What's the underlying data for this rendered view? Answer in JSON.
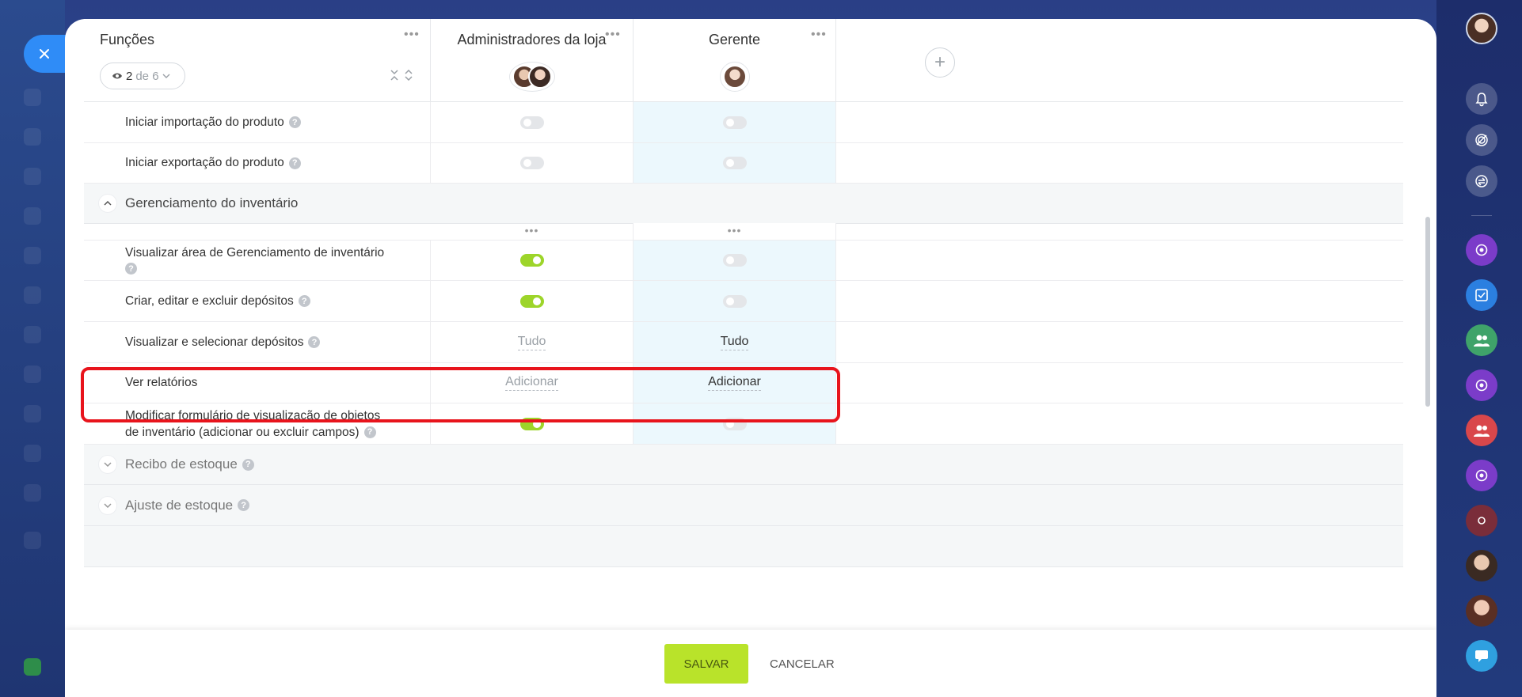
{
  "header": {
    "functions_label": "Funções",
    "filter": {
      "count": "2",
      "of_label": "de 6"
    },
    "columns": [
      {
        "title": "Administradores da loja"
      },
      {
        "title": "Gerente"
      }
    ]
  },
  "rows_top": [
    {
      "label": "Iniciar importação do produto"
    },
    {
      "label": "Iniciar exportação do produto"
    }
  ],
  "section_inventory": {
    "title": "Gerenciamento do inventário"
  },
  "rows_inventory": [
    {
      "label_line1": "Visualizar área de Gerenciamento de inventário",
      "admin": "on",
      "manager": "off"
    },
    {
      "label": "Criar, editar e excluir depósitos",
      "admin": "on",
      "manager": "off"
    },
    {
      "label": "Visualizar e selecionar depósitos",
      "admin_value": "Tudo",
      "manager_value": "Tudo"
    },
    {
      "label": "Ver relatórios",
      "admin_value": "Adicionar",
      "manager_value": "Adicionar"
    },
    {
      "label_line1": "Modificar formulário de visualização de objetos",
      "label_line2": "de inventário (adicionar ou excluir campos)",
      "admin": "on",
      "manager": "off"
    }
  ],
  "sections_collapsed": [
    {
      "title": "Recibo de estoque"
    },
    {
      "title": "Ajuste de estoque"
    }
  ],
  "footer": {
    "save_label": "SALVAR",
    "cancel_label": "CANCELAR"
  },
  "colors": {
    "accent_green": "#9dd52a",
    "save_button": "#b9e32a",
    "highlight": "#e8141c",
    "close_button": "#2f8cf7"
  }
}
